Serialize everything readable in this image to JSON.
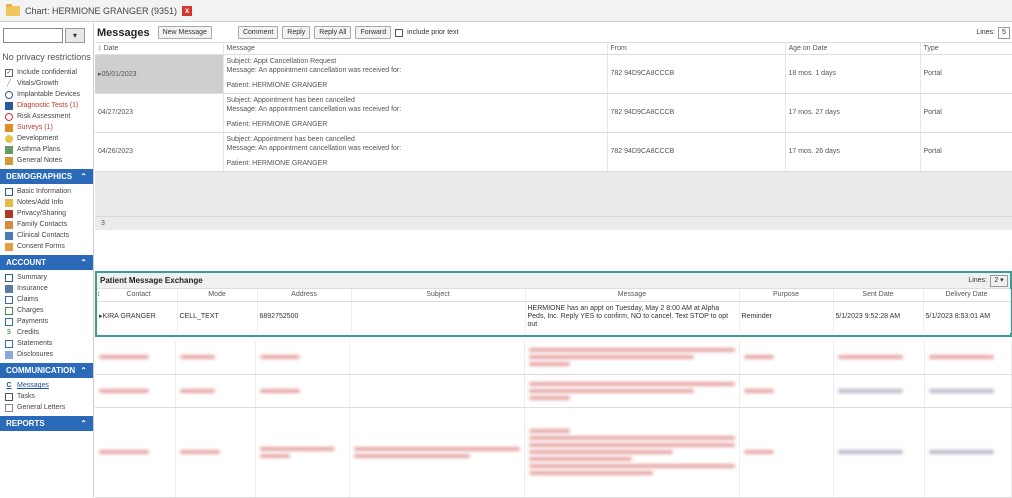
{
  "window": {
    "title": "Chart: HERMIONE GRANGER (9351)",
    "close": "x"
  },
  "sidebar": {
    "privacy": "No privacy restrictions",
    "top_items": [
      {
        "label": "Include confidential",
        "icon": "checkbox-icon"
      },
      {
        "label": "Vitals/Growth",
        "icon": "vitals-icon"
      },
      {
        "label": "Implantable Devices",
        "icon": "device-icon"
      },
      {
        "label": "Diagnostic Tests (1)",
        "icon": "chart-icon"
      },
      {
        "label": "Risk Assessment",
        "icon": "risk-icon"
      },
      {
        "label": "Surveys (1)",
        "icon": "survey-icon"
      },
      {
        "label": "Development",
        "icon": "development-icon"
      },
      {
        "label": "Asthma Plans",
        "icon": "asthma-icon"
      },
      {
        "label": "General Notes",
        "icon": "notes-icon"
      }
    ],
    "sections": [
      {
        "title": "DEMOGRAPHICS",
        "items": [
          "Basic Information",
          "Notes/Add Info",
          "Privacy/Sharing",
          "Family Contacts",
          "Clinical Contacts",
          "Consent Forms"
        ]
      },
      {
        "title": "ACCOUNT",
        "items": [
          "Summary",
          "Insurance",
          "Claims",
          "Charges",
          "Payments",
          "Credits",
          "Statements",
          "Disclosures"
        ]
      },
      {
        "title": "COMMUNICATION",
        "items": [
          "Messages",
          "Tasks",
          "General Letters"
        ]
      },
      {
        "title": "REPORTS",
        "items": []
      }
    ]
  },
  "messages": {
    "title": "Messages",
    "buttons": {
      "new": "New Message",
      "comment": "Comment",
      "reply": "Reply",
      "reply_all": "Reply All",
      "forward": "Forward",
      "include_prior": "include prior text"
    },
    "lines_label": "Lines:",
    "lines_value": "5",
    "columns": {
      "date": "Date",
      "message": "Message",
      "from": "From",
      "age": "Age on Date",
      "type": "Type"
    },
    "rows": [
      {
        "date": "05/01/2023",
        "subject": "Subject: Appt Cancellation Request",
        "body": "Message: An appointment cancellation was received for:",
        "patient": "Patient: HERMIONE GRANGER",
        "from": "782 94D9CA8CCCB",
        "age": "18 mos. 1 days",
        "type": "Portal"
      },
      {
        "date": "04/27/2023",
        "subject": "Subject: Appointment has been cancelled",
        "body": "Message: An appointment cancellation was received for:",
        "patient": "Patient: HERMIONE GRANGER",
        "from": "782 94D9CA8CCCB",
        "age": "17 mos. 27 days",
        "type": "Portal"
      },
      {
        "date": "04/26/2023",
        "subject": "Subject: Appointment has been cancelled",
        "body": "Message: An appointment cancellation was received for:",
        "patient": "Patient: HERMIONE GRANGER",
        "from": "782 94D9CA8CCCB",
        "age": "17 mos. 26 days",
        "type": "Portal"
      }
    ],
    "count": "3"
  },
  "pme": {
    "title": "Patient Message Exchange",
    "lines_label": "Lines:",
    "lines_value": "2",
    "columns": {
      "contact": "Contact",
      "mode": "Mode",
      "address": "Address",
      "subject": "Subject",
      "message": "Message",
      "purpose": "Purpose",
      "sent": "Sent Date",
      "delivery": "Delivery Date"
    },
    "row": {
      "contact": "KIRA GRANGER",
      "mode": "CELL_TEXT",
      "address": "6892752500",
      "subject": "",
      "message": "HERMIONE has an appt on Tuesday, May 2 8:00 AM at Alpha Peds, Inc. Reply YES to confirm, NO to cancel. Text STOP to opt out",
      "purpose": "Reminder",
      "sent": "5/1/2023 9:52:28 AM",
      "delivery": "5/1/2023 8:53:01 AM"
    }
  }
}
